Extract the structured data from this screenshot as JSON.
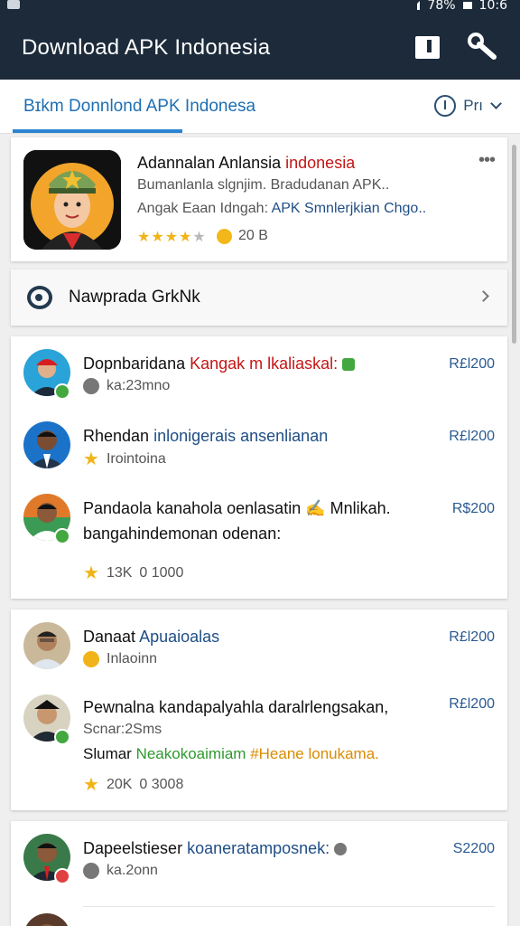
{
  "status": {
    "time": "10:6",
    "battery": "78%"
  },
  "appbar": {
    "title": "Download APK Indonesia"
  },
  "tab": {
    "label": "Bɪkm Donnlond APK Indonesa",
    "filter_label": "Prı"
  },
  "app": {
    "name_prefix": "Adannalan Anlansia ",
    "name_highlight": "indonesia",
    "desc1": "Bumanlanla slgnjim. Bradudanan APK..",
    "desc2_prefix": "Angak  Eaan Idngah: ",
    "desc2_highlight": "APK Smnlerjkian Chgo..",
    "stars_on": "★★★★",
    "stars_off": "★",
    "downloads": "20 B",
    "more": "•••"
  },
  "section": {
    "title": "Nawprada GrkNk"
  },
  "reviews": [
    {
      "name": "Dopnbaridana ",
      "highlight": "Kangak m lkaliaskal:",
      "meta": "ka:23mno",
      "price": "R£l200"
    },
    {
      "name": "Rhendan ",
      "highlight": "inlonigerais ansenlianan",
      "meta": "Irointoina",
      "price": "R£l200"
    },
    {
      "line1": "Pandaola kanahola oenlasatin ✍ Mnlikah.",
      "line2": "bangahindemonan odenan:",
      "rating": "13K",
      "views": "0 1000",
      "price": "R$200"
    },
    {
      "name": "Danaat ",
      "highlight": "Apuaioalas",
      "meta": "Inlaoinn",
      "price": "R£l200"
    },
    {
      "line1": "Pewnalna kandapalyahla daralrlengsakan,",
      "line2": "Scnar:2Sms",
      "line3_prefix": "Slumar ",
      "line3_green": "Neakokoaimiam",
      "line3_orange": " #Heane lonukama.",
      "rating": "20K",
      "views": "0 3008",
      "price": "R£l200"
    },
    {
      "name": "Dapeelstieser ",
      "highlight": "koaneratamposnek:",
      "meta": "ka.2onn",
      "price": "S2200"
    }
  ]
}
